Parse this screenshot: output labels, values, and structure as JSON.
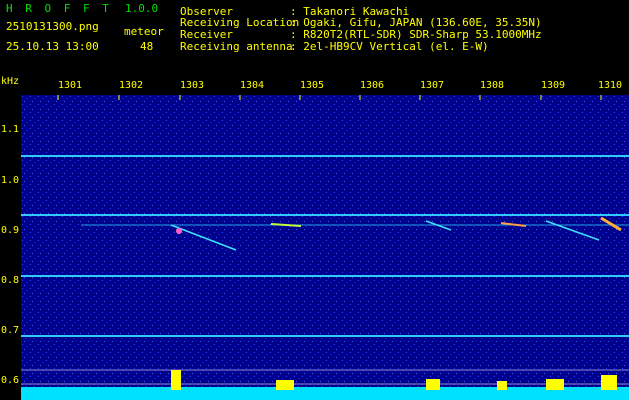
{
  "header": {
    "app_title": "H R O F F T",
    "version": "1.0.0",
    "filename": "2510131300.png",
    "datetime": "25.10.13 13:00",
    "meteor_label": "meteor",
    "meteor_count": "48",
    "fields": [
      {
        "label": "Observer",
        "value": ": Takanori Kawachi"
      },
      {
        "label": "Receiving Location",
        "value": ": Ogaki, Gifu, JAPAN (136.60E, 35.35N)"
      },
      {
        "label": "Receiver",
        "value": ": R820T2(RTL-SDR) SDR-Sharp 53.1000MHz"
      },
      {
        "label": "Receiving antenna",
        "value": ": 2el-HB9CV Vertical (el. E-W)"
      }
    ]
  },
  "axis": {
    "unit": "kHz",
    "y_ticks": [
      "1.1",
      "1.0",
      "0.9",
      "0.8",
      "0.7",
      "0.6"
    ],
    "x_ticks": [
      "1301",
      "1302",
      "1303",
      "1304",
      "1305",
      "1306",
      "1307",
      "1308",
      "1309",
      "1310"
    ]
  },
  "colors": {
    "background": "#00008a",
    "text": "#ffff00",
    "title": "#00e000",
    "signal": "#00ffff"
  }
}
